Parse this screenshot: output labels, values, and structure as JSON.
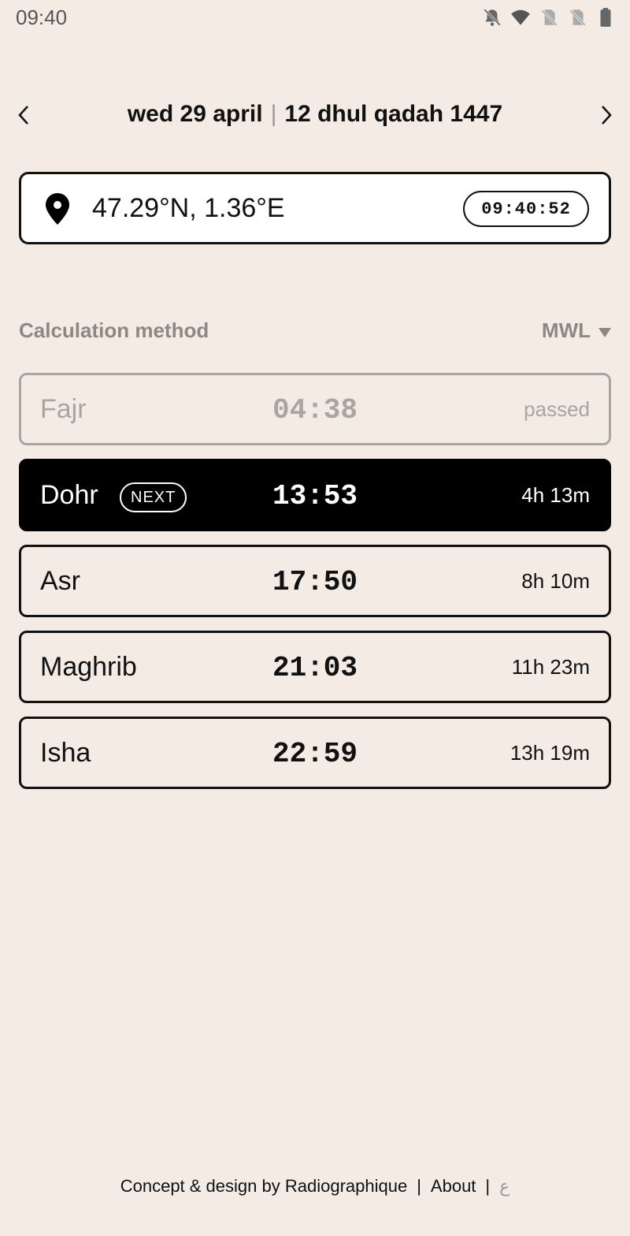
{
  "status_bar": {
    "time": "09:40",
    "icons": [
      "bell-off-icon",
      "wifi-icon",
      "sim-off-icon",
      "sim-off-icon",
      "battery-icon"
    ]
  },
  "date_nav": {
    "gregorian": "wed 29 april",
    "separator": "|",
    "hijri": "12 dhul qadah 1447"
  },
  "location": {
    "coords": "47.29°N, 1.36°E",
    "clock": "09:40:52"
  },
  "calculation": {
    "label": "Calculation method",
    "value": "MWL"
  },
  "prayers": [
    {
      "name": "Fajr",
      "time": "04:38",
      "remaining": "passed",
      "state": "passed"
    },
    {
      "name": "Dohr",
      "time": "13:53",
      "remaining": "4h 13m",
      "state": "next",
      "badge": "NEXT"
    },
    {
      "name": "Asr",
      "time": "17:50",
      "remaining": "8h 10m",
      "state": "upcoming"
    },
    {
      "name": "Maghrib",
      "time": "21:03",
      "remaining": "11h 23m",
      "state": "upcoming"
    },
    {
      "name": "Isha",
      "time": "22:59",
      "remaining": "13h 19m",
      "state": "upcoming"
    }
  ],
  "footer": {
    "credit": "Concept & design by Radiographique",
    "sep": "|",
    "about": "About",
    "arabic": "ع"
  },
  "colors": {
    "background": "#f3ebe4",
    "ink": "#111111",
    "muted": "#8d8884"
  }
}
